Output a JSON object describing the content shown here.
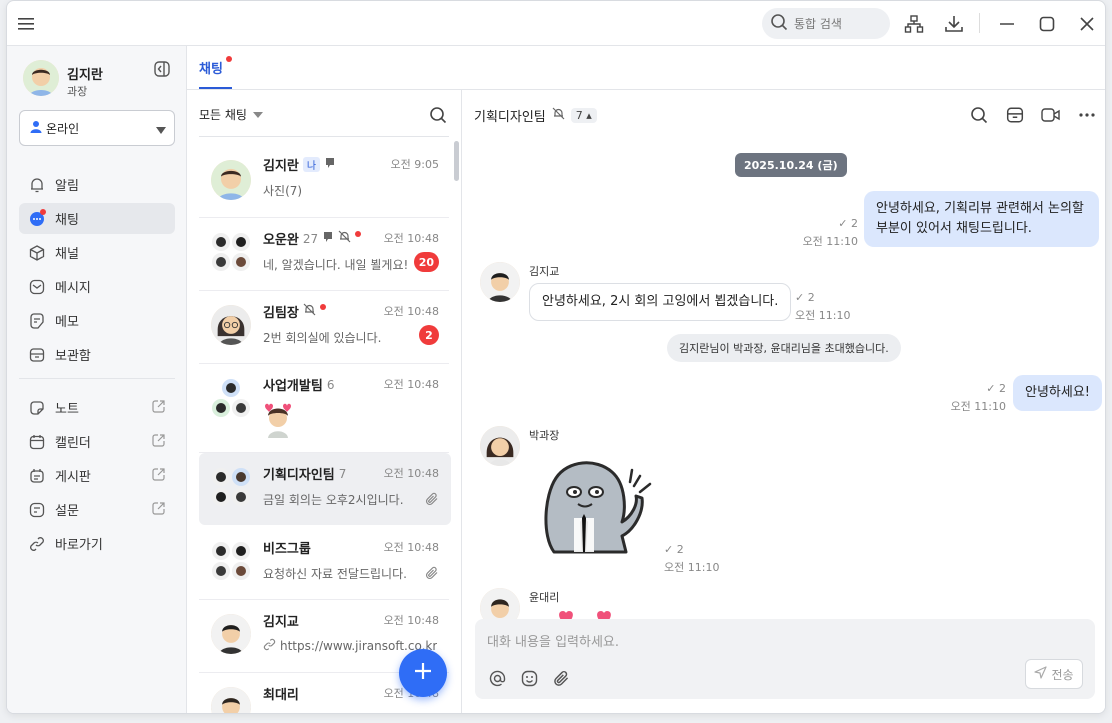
{
  "titlebar": {
    "search_placeholder": "통합 검색"
  },
  "profile": {
    "name": "김지란",
    "title": "과장",
    "status": "온라인"
  },
  "sidebar": {
    "items": [
      {
        "label": "알림",
        "icon": "bell-icon"
      },
      {
        "label": "채팅",
        "icon": "chat-icon"
      },
      {
        "label": "채널",
        "icon": "box-icon"
      },
      {
        "label": "메시지",
        "icon": "mail-icon"
      },
      {
        "label": "메모",
        "icon": "memo-icon"
      },
      {
        "label": "보관함",
        "icon": "archive-icon"
      }
    ],
    "apps": [
      {
        "label": "노트",
        "icon": "note-icon"
      },
      {
        "label": "캘린더",
        "icon": "calendar-icon"
      },
      {
        "label": "게시판",
        "icon": "board-icon"
      },
      {
        "label": "설문",
        "icon": "survey-icon"
      },
      {
        "label": "바로가기",
        "icon": "link-icon"
      }
    ]
  },
  "tabs": {
    "chat": "채팅"
  },
  "chatlist": {
    "filter_label": "모든 채팅",
    "rooms": [
      {
        "name": "김지란",
        "me": "나",
        "count": "",
        "time": "오전 9:05",
        "message": "사진(7)",
        "badge": ""
      },
      {
        "name": "오운완",
        "count": "27",
        "time": "오전 10:48",
        "message": "네, 알겠습니다. 내일 뵐게요!",
        "badge": "20"
      },
      {
        "name": "김팀장",
        "count": "",
        "time": "오전 10:48",
        "message": "2번 회의실에 있습니다.",
        "badge": "2"
      },
      {
        "name": "사업개발팀",
        "count": "6",
        "time": "오전 10:48",
        "message": "",
        "badge": ""
      },
      {
        "name": "기획디자인팀",
        "count": "7",
        "time": "오전 10:48",
        "message": "금일 회의는 오후2시입니다.",
        "badge": ""
      },
      {
        "name": "비즈그룹",
        "count": "",
        "time": "오전 10:48",
        "message": "요청하신 자료 전달드립니다.",
        "badge": ""
      },
      {
        "name": "김지교",
        "count": "",
        "time": "오전 10:48",
        "message": "https://www.jiransoft.co.kr",
        "badge": ""
      },
      {
        "name": "최대리",
        "count": "",
        "time": "오전 10:48",
        "message": "",
        "badge": ""
      }
    ]
  },
  "conversation": {
    "title": "기획디자인팀",
    "member_count": "7",
    "date": "2025.10.24 (금)",
    "messages": [
      {
        "sender": "",
        "text_line1": "안녕하세요, 기획리뷰 관련해서 논의할",
        "text_line2": "부분이 있어서 채팅드립니다.",
        "read": "✓ 2",
        "time": "오전 11:10"
      },
      {
        "sender": "김지교",
        "text": "안녕하세요, 2시 회의 고잉에서 뵙겠습니다.",
        "read": "✓ 2",
        "time": "오전 11:10"
      },
      {
        "system": "김지란님이 박과장, 윤대리님을 초대했습니다."
      },
      {
        "sender": "",
        "text": "안녕하세요!",
        "read": "✓ 2",
        "time": "오전 11:10"
      },
      {
        "sender": "박과장",
        "sticker": "ghost-sticker",
        "read": "✓ 2",
        "time": "오전 11:10"
      },
      {
        "sender": "윤대리"
      }
    ],
    "composer_placeholder": "대화 내용을 입력하세요.",
    "send_label": "전송"
  },
  "colors": {
    "accent": "#2f6df6",
    "badge": "#f03b3b",
    "my_bubble": "#dbe7fd"
  }
}
